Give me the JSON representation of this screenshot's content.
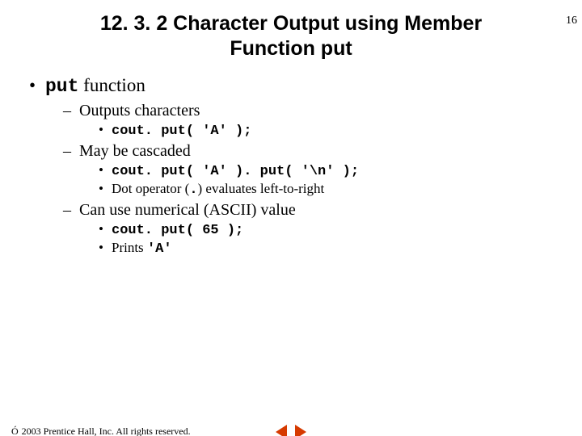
{
  "pageNumber": "16",
  "title": "12. 3. 2 Character Output using Member Function put",
  "bullets": {
    "l1_text_prefix": "put",
    "l1_text_suffix": " function",
    "l2a": "Outputs characters",
    "l3a1": "cout. put( 'A' );",
    "l2b": "May be cascaded",
    "l3b1": "cout. put( 'A' ). put( '\\n' );",
    "l3b2_pre": "Dot operator (",
    "l3b2_op": ".",
    "l3b2_post": ") evaluates left-to-right",
    "l2c": "Can use numerical (ASCII) value",
    "l3c1": "cout. put( 65 );",
    "l3c2_pre": "Prints ",
    "l3c2_code": "'A'"
  },
  "footer": {
    "copySymbol": "Ó",
    "copyText": "2003 Prentice Hall, Inc. All rights reserved."
  }
}
